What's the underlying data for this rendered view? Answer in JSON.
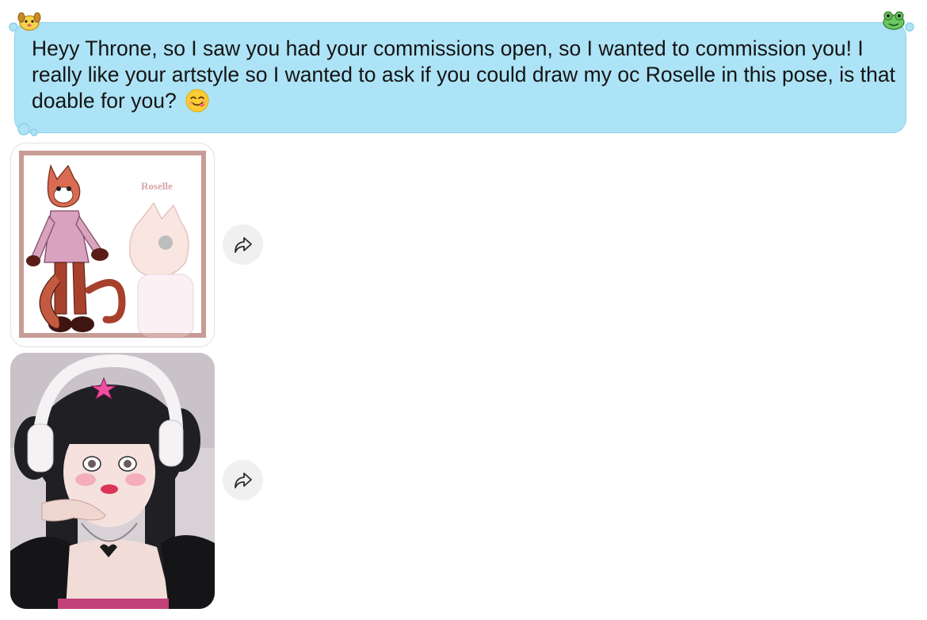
{
  "message": {
    "text": "Heyy Throne, so I saw you had your commissions open, so I wanted to commission you! I really like your artstyle so I wanted to ask if you could draw my oc Roselle in this pose, is that doable for you?",
    "emoji": "😋",
    "bubble_color": "#ade3f6",
    "stickers": [
      "dog-sticker-icon",
      "frog-sticker-icon"
    ]
  },
  "attachments": [
    {
      "kind": "image",
      "description_name": "character-reference-sheet",
      "caption_in_image": "Roselle"
    },
    {
      "kind": "image",
      "description_name": "pose-reference-photo"
    }
  ],
  "share_icon": "share-icon"
}
